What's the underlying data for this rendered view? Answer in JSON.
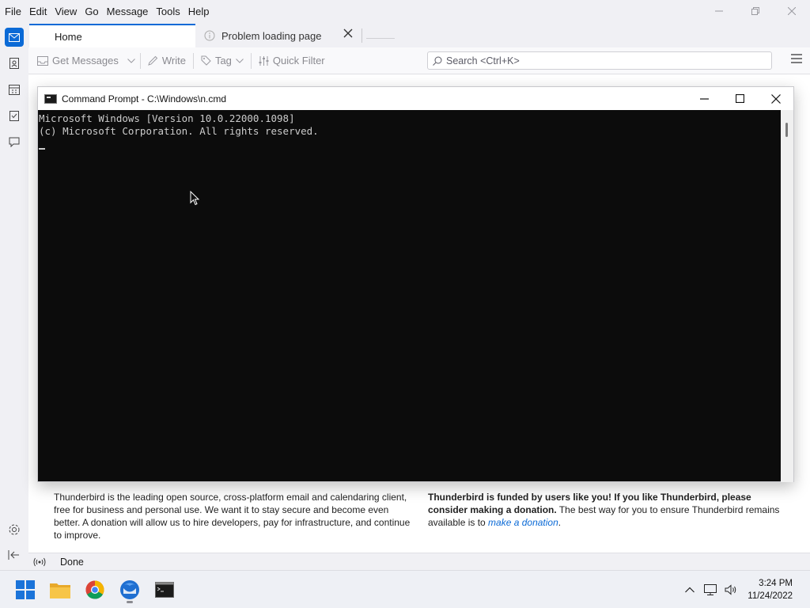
{
  "menubar": {
    "items": [
      "File",
      "Edit",
      "View",
      "Go",
      "Message",
      "Tools",
      "Help"
    ]
  },
  "tabs": {
    "home": "Home",
    "problem": "Problem loading page"
  },
  "toolbar": {
    "get_messages": "Get Messages",
    "write": "Write",
    "tag": "Tag",
    "quick_filter": "Quick Filter",
    "search_placeholder": "Search <Ctrl+K>"
  },
  "home_content": {
    "left_text": "Thunderbird is the leading open source, cross-platform email and calendaring client, free for business and personal use. We want it to stay secure and become even better. A donation will allow us to hire developers, pay for infrastructure, and continue to improve.",
    "right_bold_1": "Thunderbird is funded by users like you! If you like Thunderbird, please consider making a donation.",
    "right_text": " The best way for you to ensure Thunderbird remains available is to ",
    "right_link": "make a donation",
    "right_end": "."
  },
  "statusbar": {
    "status": "Done"
  },
  "cmd": {
    "title": "Command Prompt - C:\\Windows\\n.cmd",
    "line1": "Microsoft Windows [Version 10.0.22000.1098]",
    "line2": "(c) Microsoft Corporation. All rights reserved."
  },
  "taskbar": {
    "time": "3:24 PM",
    "date": "11/24/2022",
    "apps": [
      "windows-start-icon",
      "file-explorer-icon",
      "chrome-icon",
      "thunderbird-icon",
      "command-prompt-icon"
    ]
  },
  "colors": {
    "accent": "#0b6ad6",
    "cmd_bg": "#0c0c0c",
    "cmd_text": "#cccccc"
  }
}
